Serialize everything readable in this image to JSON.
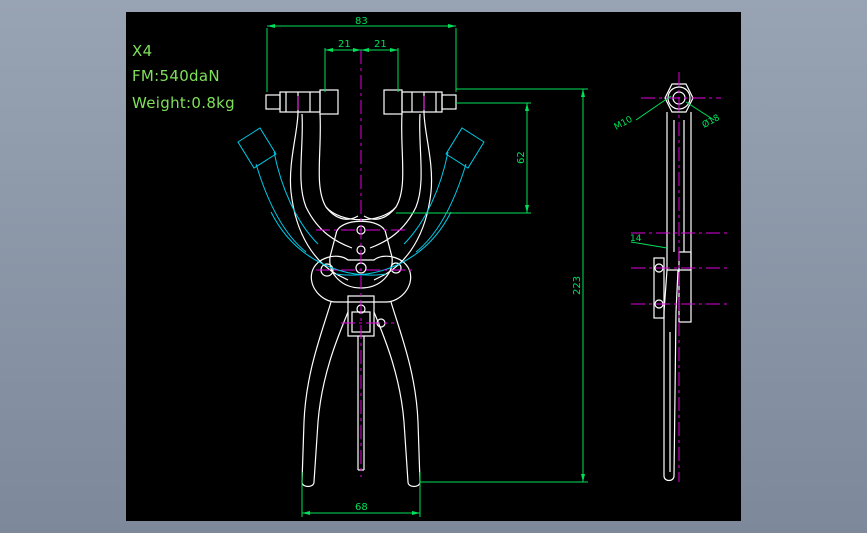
{
  "annotations": {
    "quantity": "X4",
    "force": "FM:540daN",
    "weight": "Weight:0.8kg"
  },
  "dimensions": {
    "top_width": "83",
    "left_half": "21",
    "right_half": "21",
    "stroke_height": "62",
    "overall_height": "223",
    "bottom_width": "68",
    "thread": "M10",
    "diameter": "Ø18",
    "side_offset": "14"
  },
  "colors": {
    "background": "#000000",
    "outline": "#ffffff",
    "dimension": "#00e05a",
    "center_line": "#e000e0",
    "phantom": "#00c8e6"
  }
}
